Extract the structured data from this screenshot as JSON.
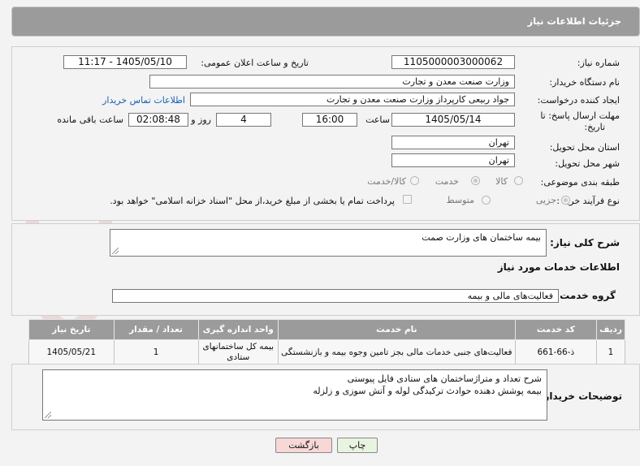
{
  "header": {
    "title": "جزئیات اطلاعات نیاز"
  },
  "watermark": {
    "text": "AriaTender.neT"
  },
  "form": {
    "need_number_label": "شماره نیاز:",
    "need_number": "1105000003000062",
    "announce_label": "تاریخ و ساعت اعلان عمومی:",
    "announce_value": "1405/05/10 - 11:17",
    "buyer_org_label": "نام دستگاه خریدار:",
    "buyer_org": "وزارت صنعت معدن و تجارت",
    "creator_label": "ایجاد کننده درخواست:",
    "creator": "جواد ربیعی کارپرداز وزارت صنعت معدن و تجارت",
    "contact_link": "اطلاعات تماس خریدار",
    "deadline_label_1": "مهلت ارسال پاسخ: تا",
    "deadline_label_2": "تاریخ:",
    "deadline_date": "1405/05/14",
    "time_label": "ساعت",
    "deadline_time": "16:00",
    "days_value": "4",
    "days_label": "روز و",
    "remaining_time": "02:08:48",
    "remaining_label": "ساعت باقی مانده",
    "province_label": "استان محل تحویل:",
    "province": "تهران",
    "city_label": "شهر محل تحویل:",
    "city": "تهران",
    "category_label": "طبقه بندی موضوعی:",
    "category_options": [
      "کالا",
      "خدمت",
      "کالا/خدمت"
    ],
    "category_selected": "خدمت",
    "process_label": "نوع فرآیند خرید :",
    "process_options": [
      "جزیی",
      "متوسط"
    ],
    "process_selected": "جزیی",
    "payment_note": "پرداخت تمام یا بخشی از مبلغ خرید،از محل \"اسناد خزانه اسلامی\" خواهد بود."
  },
  "summary": {
    "need_desc_label": "شرح کلی نیاز:",
    "need_desc": "بیمه ساختمان های وزارت صمت",
    "services_heading": "اطلاعات خدمات مورد نیاز",
    "service_group_label": "گروه خدمت:",
    "service_group": "فعالیت‌های مالی و بیمه"
  },
  "table": {
    "headers": [
      "ردیف",
      "کد خدمت",
      "نام خدمت",
      "واحد اندازه گیری",
      "تعداد / مقدار",
      "تاریخ نیاز"
    ],
    "rows": [
      [
        "1",
        "ذ-66-661",
        "فعالیت‌های جنبی خدمات مالی بجز تامین وجوه بیمه و بازنشستگی",
        "بیمه کل ساختمانهای ستادی",
        "1",
        "1405/05/21"
      ]
    ]
  },
  "buyer_notes": {
    "label": "توضیحات خریدار:",
    "line1": "شرح تعداد و متراژساختمان های ستادی فایل پیوستی",
    "line2": "بیمه پوشش دهنده حوادث ترکیدگی لوله  و آتش سوزی  و زلزله"
  },
  "buttons": {
    "print": "چاپ",
    "back": "بازگشت"
  },
  "colors": {
    "header_bg": "#9b9b9b",
    "link": "#1a5fb4",
    "back_btn": "#f8d7d7",
    "print_btn": "#e8f4e0"
  }
}
